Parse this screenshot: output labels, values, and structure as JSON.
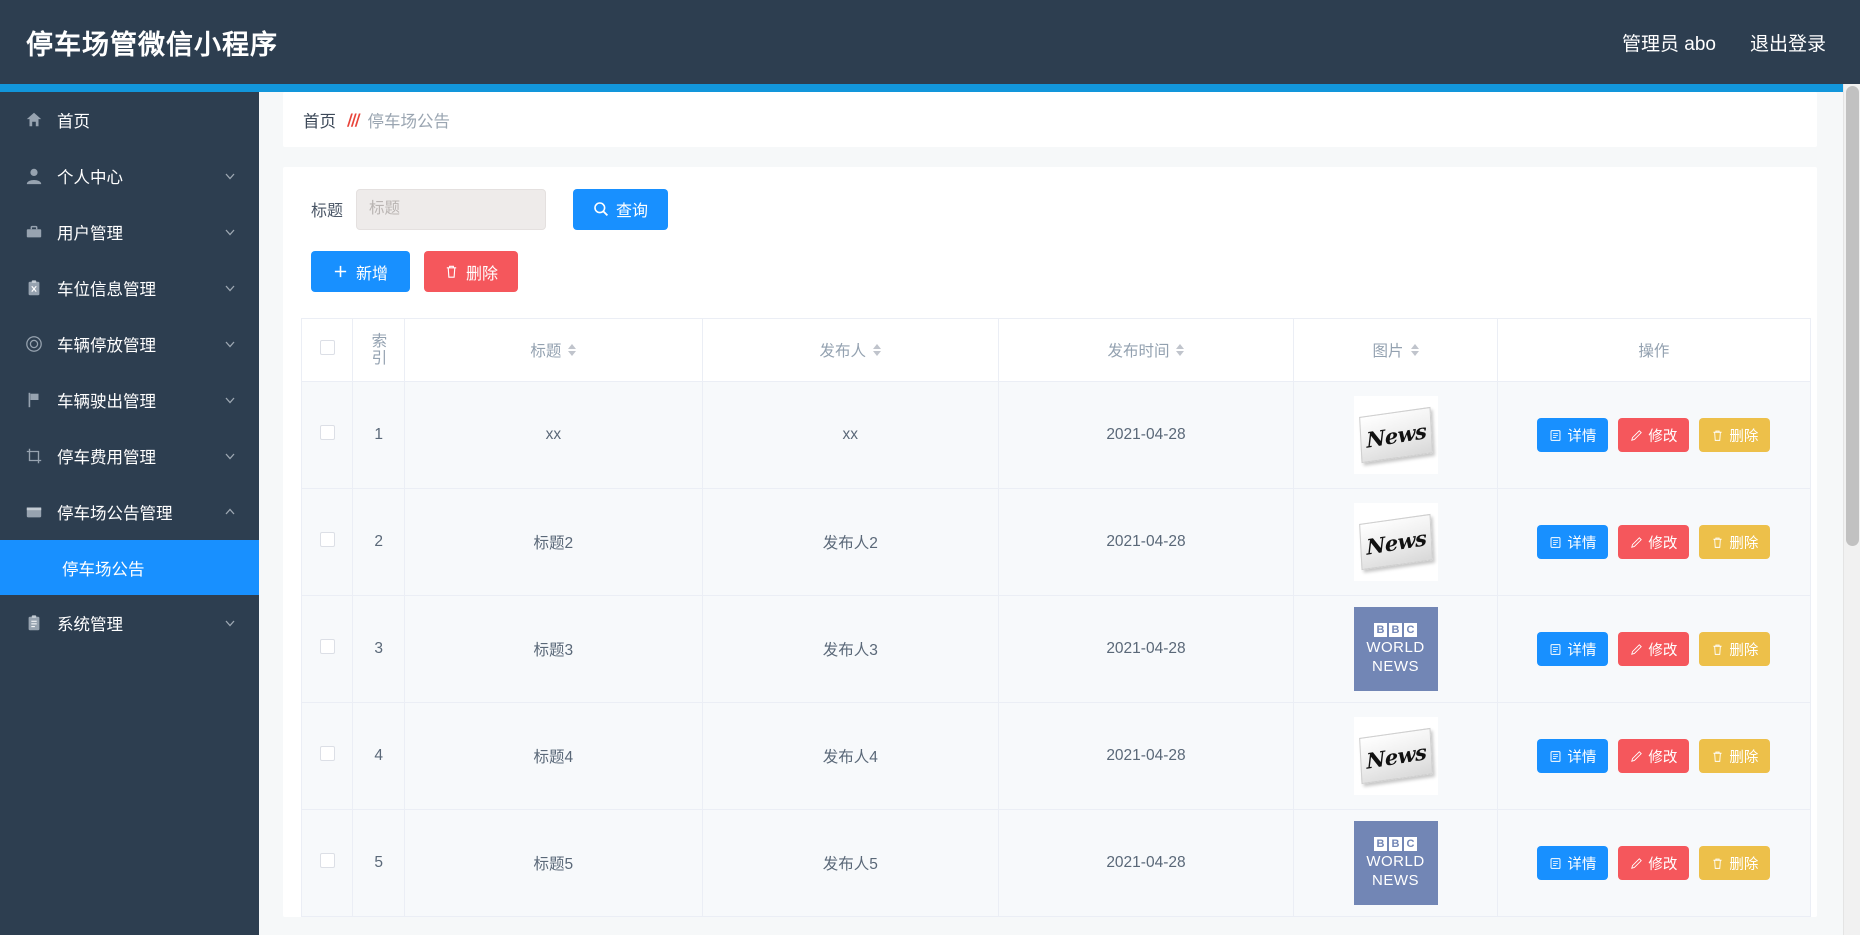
{
  "header": {
    "brand": "停车场管微信小程序",
    "user": "管理员 abo",
    "logout": "退出登录"
  },
  "sidebar": {
    "items": [
      {
        "label": "首页",
        "icon": "home-icon",
        "arrow": "",
        "active": false
      },
      {
        "label": "个人中心",
        "icon": "user-icon",
        "arrow": "chevron-down-icon",
        "active": false
      },
      {
        "label": "用户管理",
        "icon": "briefcase-icon",
        "arrow": "chevron-down-icon",
        "active": false
      },
      {
        "label": "车位信息管理",
        "icon": "clipboard-x-icon",
        "arrow": "chevron-down-icon",
        "active": false
      },
      {
        "label": "车辆停放管理",
        "icon": "circle-target-icon",
        "arrow": "chevron-down-icon",
        "active": false
      },
      {
        "label": "车辆驶出管理",
        "icon": "flag-icon",
        "arrow": "chevron-down-icon",
        "active": false
      },
      {
        "label": "停车费用管理",
        "icon": "crop-icon",
        "arrow": "chevron-down-icon",
        "active": false
      },
      {
        "label": "停车场公告管理",
        "icon": "window-icon",
        "arrow": "chevron-up-icon",
        "active": false
      }
    ],
    "sub_item": {
      "label": "停车场公告",
      "active": true
    },
    "last_item": {
      "label": "系统管理",
      "icon": "clipboard-icon",
      "arrow": "chevron-down-icon"
    }
  },
  "breadcrumb": {
    "home": "首页",
    "separator": "///",
    "current": "停车场公告"
  },
  "search": {
    "label": "标题",
    "placeholder": "标题",
    "value": "",
    "query_button": "查询",
    "query_icon": "search-icon"
  },
  "actions": {
    "add": "新增",
    "add_icon": "plus-icon",
    "delete": "删除",
    "delete_icon": "trash-icon"
  },
  "table": {
    "columns": [
      {
        "key": "checkbox",
        "label": "",
        "sortable": false
      },
      {
        "key": "index",
        "label": "索引",
        "sortable": false
      },
      {
        "key": "title",
        "label": "标题",
        "sortable": true
      },
      {
        "key": "publisher",
        "label": "发布人",
        "sortable": true
      },
      {
        "key": "publish_time",
        "label": "发布时间",
        "sortable": true
      },
      {
        "key": "image",
        "label": "图片",
        "sortable": true
      },
      {
        "key": "operation",
        "label": "操作",
        "sortable": false
      }
    ],
    "row_buttons": {
      "detail": "详情",
      "detail_icon": "document-icon",
      "edit": "修改",
      "edit_icon": "pencil-icon",
      "delete": "删除",
      "delete_icon": "trash-icon"
    },
    "rows": [
      {
        "index": "1",
        "title": "xx",
        "publisher": "xx",
        "publish_time": "2021-04-28",
        "image": "news-thumbnail"
      },
      {
        "index": "2",
        "title": "标题2",
        "publisher": "发布人2",
        "publish_time": "2021-04-28",
        "image": "news-thumbnail"
      },
      {
        "index": "3",
        "title": "标题3",
        "publisher": "发布人3",
        "publish_time": "2021-04-28",
        "image": "bbc-world-news-thumbnail"
      },
      {
        "index": "4",
        "title": "标题4",
        "publisher": "发布人4",
        "publish_time": "2021-04-28",
        "image": "news-thumbnail"
      },
      {
        "index": "5",
        "title": "标题5",
        "publisher": "发布人5",
        "publish_time": "2021-04-28",
        "image": "bbc-world-news-thumbnail"
      }
    ]
  },
  "colors": {
    "header_bg": "#2d3e50",
    "accent_blue": "#1890ff",
    "stripe_blue": "#1296db",
    "danger_red": "#f5575c",
    "warn_yellow": "#edc04a",
    "breadcrumb_sep": "#e8443a",
    "bbc_bg": "#7286b5"
  }
}
